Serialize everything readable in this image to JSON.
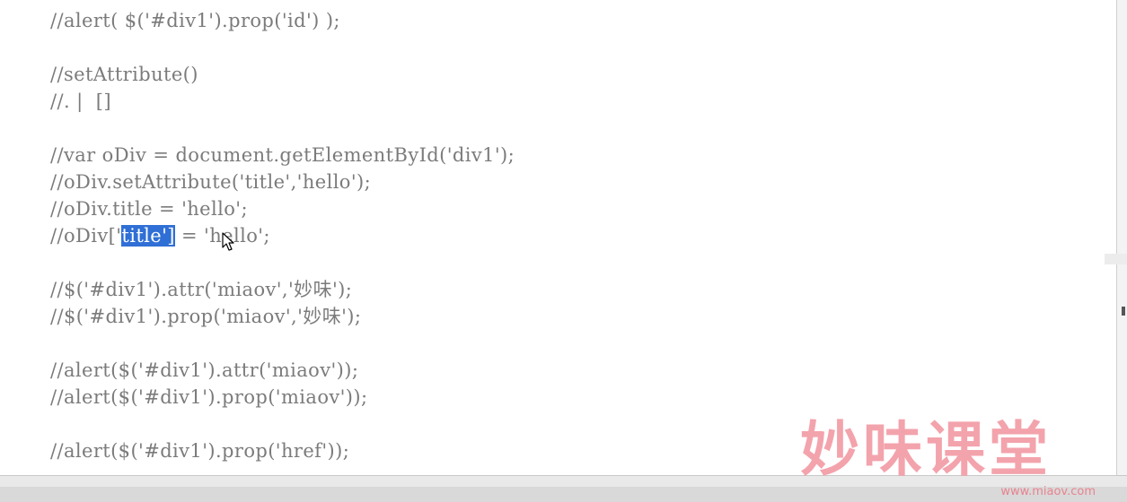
{
  "editor": {
    "lines": [
      "//alert( $('#div1').prop('id') );",
      "",
      "//setAttribute()",
      "//. |  []",
      "",
      "//var oDiv = document.getElementById('div1');",
      "//oDiv.setAttribute('title','hello');",
      "//oDiv.title = 'hello';",
      "",
      "",
      "//$('#div1').attr('miaov','妙味');",
      "//$('#div1').prop('miaov','妙味');",
      "",
      "//alert($('#div1').attr('miaov'));",
      "//alert($('#div1').prop('miaov'));",
      "",
      "//alert($('#div1').prop('href'));"
    ],
    "selected_line": {
      "before": "//oDiv['",
      "selection": "title']",
      "after": " = 'hello';"
    }
  },
  "watermark": {
    "brand": "妙味课堂",
    "url": "www.miaov.com"
  },
  "colors": {
    "code_text": "#7b7b7b",
    "selection_bg": "#2f6fd6",
    "watermark": "#f29aa4"
  },
  "icons": {
    "cursor": "mouse-pointer-icon"
  }
}
